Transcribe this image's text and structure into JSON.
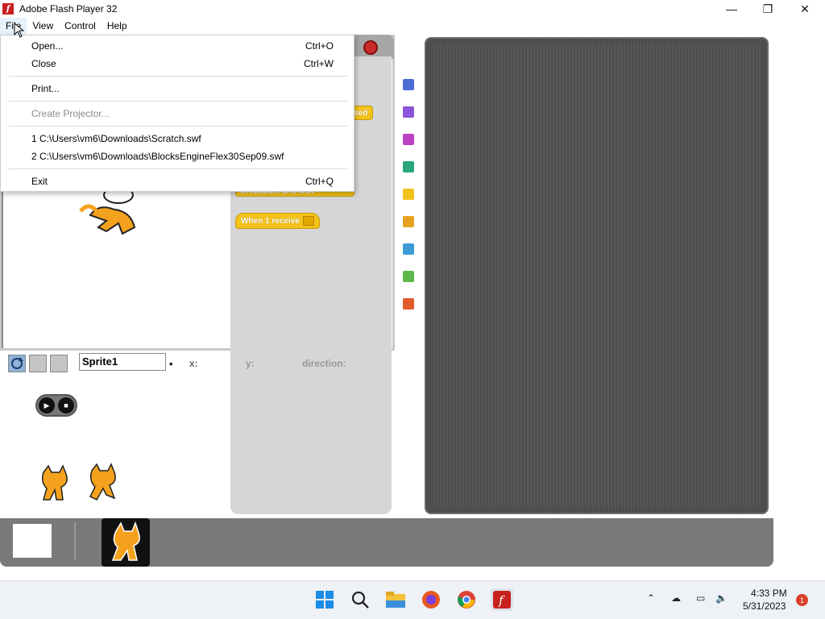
{
  "window": {
    "title": "Adobe Flash Player 32",
    "minimize_glyph": "—",
    "maximize_glyph": "❐",
    "close_glyph": "✕"
  },
  "menubar": {
    "items": [
      {
        "label": "File"
      },
      {
        "label": "View"
      },
      {
        "label": "Control"
      },
      {
        "label": "Help"
      }
    ]
  },
  "file_menu": {
    "open": {
      "label": "Open...",
      "shortcut": "Ctrl+O"
    },
    "close": {
      "label": "Close",
      "shortcut": "Ctrl+W"
    },
    "print": {
      "label": "Print..."
    },
    "create_projector": {
      "label": "Create Projector..."
    },
    "recent1": {
      "label": "1 C:\\Users\\vm6\\Downloads\\Scratch.swf"
    },
    "recent2": {
      "label": "2 C:\\Users\\vm6\\Downloads\\BlocksEngineFlex30Sep09.swf"
    },
    "exit": {
      "label": "Exit",
      "shortcut": "Ctrl+Q"
    }
  },
  "palette": {
    "block_clicked": "sed",
    "block_broadcast": "broadcast      and wait",
    "block_receive": "When 1 receive"
  },
  "categories": {
    "colors": [
      "#4a6cd4",
      "#8a55d7",
      "#bb42c3",
      "#29a680",
      "#f1c21b",
      "#e6a121",
      "#3d9bd6",
      "#5cb84a",
      "#e35b2a"
    ]
  },
  "sprite_info": {
    "name": "Sprite1",
    "x_label": "x:",
    "y_label": "y:",
    "direction_label": "direction:"
  },
  "taskbar": {
    "time": "4:33 PM",
    "date": "5/31/2023",
    "notifications": "1"
  }
}
